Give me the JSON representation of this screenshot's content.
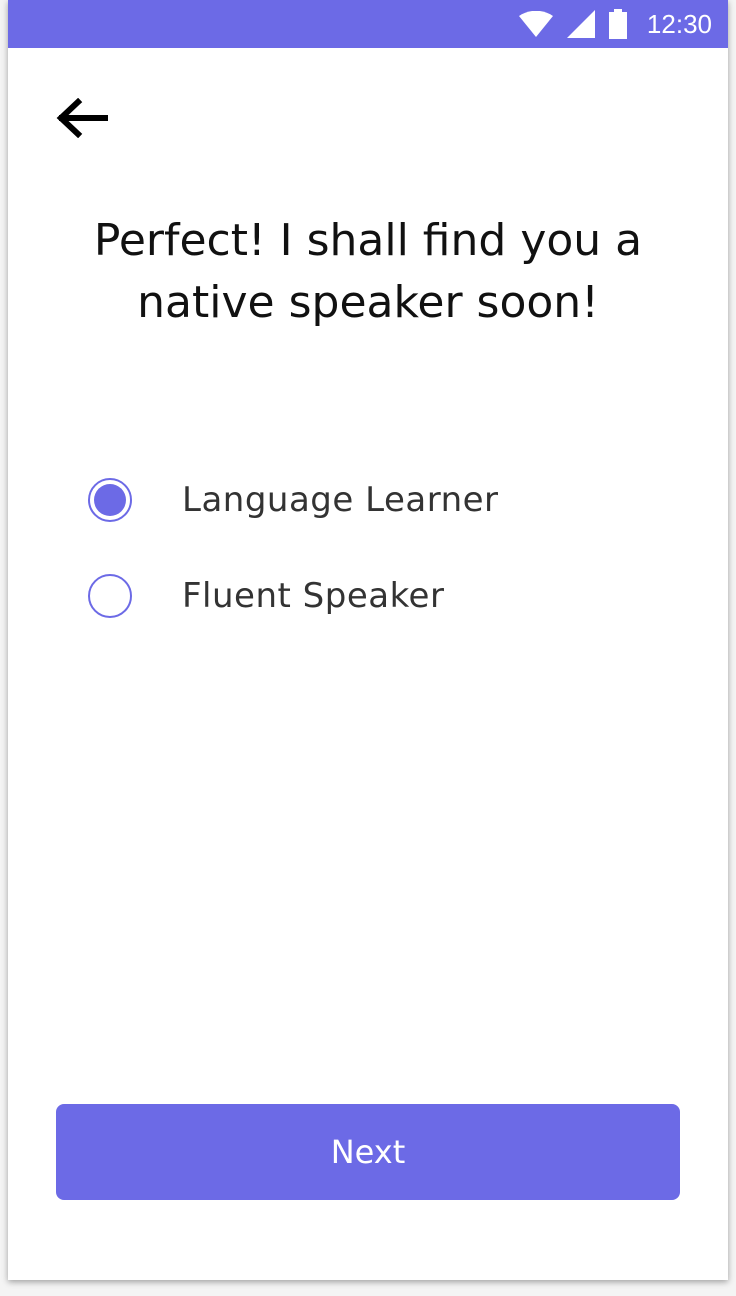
{
  "colors": {
    "accent": "#6c6ae6",
    "background": "#ffffff",
    "title_text": "#111111",
    "option_text": "#333333"
  },
  "status_bar": {
    "time": "12:30",
    "icons": [
      "wifi-icon",
      "cellular-signal-icon",
      "battery-icon"
    ]
  },
  "header": {
    "back_icon": "arrow-left-icon"
  },
  "title": {
    "line1": "Perfect! I shall find you a",
    "line2": "native speaker soon!"
  },
  "options": [
    {
      "label": "Language Learner",
      "selected": true
    },
    {
      "label": "Fluent Speaker",
      "selected": false
    }
  ],
  "footer": {
    "next_label": "Next"
  }
}
